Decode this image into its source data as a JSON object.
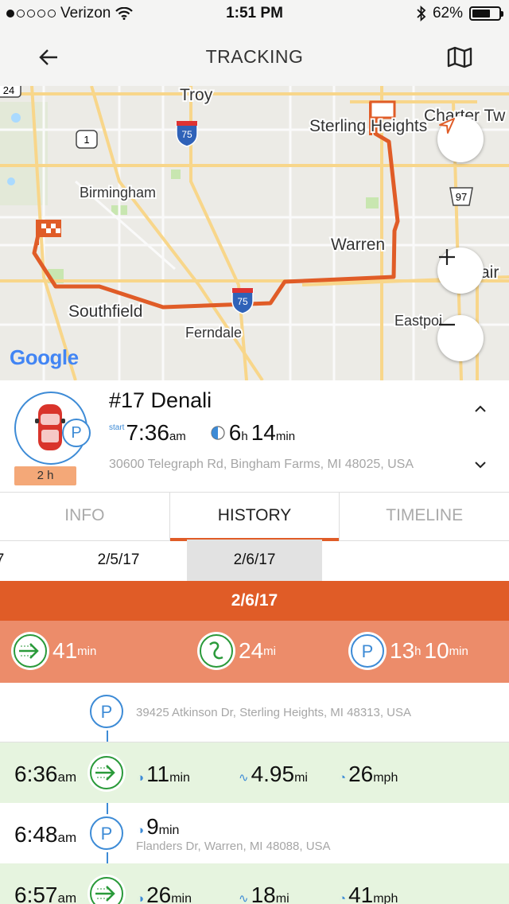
{
  "status_bar": {
    "carrier": "Verizon",
    "time": "1:51 PM",
    "battery": "62%"
  },
  "nav": {
    "title": "TRACKING"
  },
  "map": {
    "labels": [
      "Troy",
      "Sterling Heights",
      "Charter Tw",
      "Birmingham",
      "Warren",
      "Southfield",
      "Ferndale",
      "Eastpoi",
      "air"
    ],
    "shields": [
      "24",
      "1",
      "75",
      "97",
      "75"
    ],
    "google": "Google"
  },
  "vehicle": {
    "name": "#17 Denali",
    "parked_duration": "2 h",
    "start_label": "start",
    "start_time": "7:36",
    "start_ampm": "am",
    "elapsed_h": "6",
    "elapsed_h_unit": "h",
    "elapsed_m": "14",
    "elapsed_m_unit": "min",
    "address": "30600 Telegraph Rd, Bingham Farms, MI 48025, USA"
  },
  "tabs": [
    {
      "label": "INFO",
      "active": false
    },
    {
      "label": "HISTORY",
      "active": true
    },
    {
      "label": "TIMELINE",
      "active": false
    }
  ],
  "dates": [
    "7",
    "2/5/17",
    "2/6/17"
  ],
  "selected_date": "2/6/17",
  "day": {
    "title": "2/6/17",
    "drive_value": "41",
    "drive_unit": "min",
    "distance_value": "24",
    "distance_unit": "mi",
    "parked_h": "13",
    "parked_h_unit": "h",
    "parked_m": "10",
    "parked_m_unit": "min"
  },
  "timeline": {
    "first_stop_address": "39425 Atkinson Dr, Sterling Heights, MI 48313, USA",
    "rows": [
      {
        "type": "drive",
        "time": "6:36",
        "ampm": "am",
        "duration": "11",
        "duration_unit": "min",
        "distance": "4.95",
        "distance_unit": "mi",
        "speed": "26",
        "speed_unit": "mph"
      },
      {
        "type": "park",
        "time": "6:48",
        "ampm": "am",
        "duration": "9",
        "duration_unit": "min",
        "address": "Flanders Dr, Warren, MI 48088, USA"
      },
      {
        "type": "drive",
        "time": "6:57",
        "ampm": "am",
        "duration": "26",
        "duration_unit": "min",
        "distance": "18",
        "distance_unit": "mi",
        "speed": "41",
        "speed_unit": "mph"
      }
    ]
  },
  "colors": {
    "accent": "#e05c27",
    "summary_bg": "#ec8c6a",
    "drive_row": "#e6f4df",
    "parking_blue": "#3d8bd6",
    "drive_green": "#2a9a3a"
  }
}
